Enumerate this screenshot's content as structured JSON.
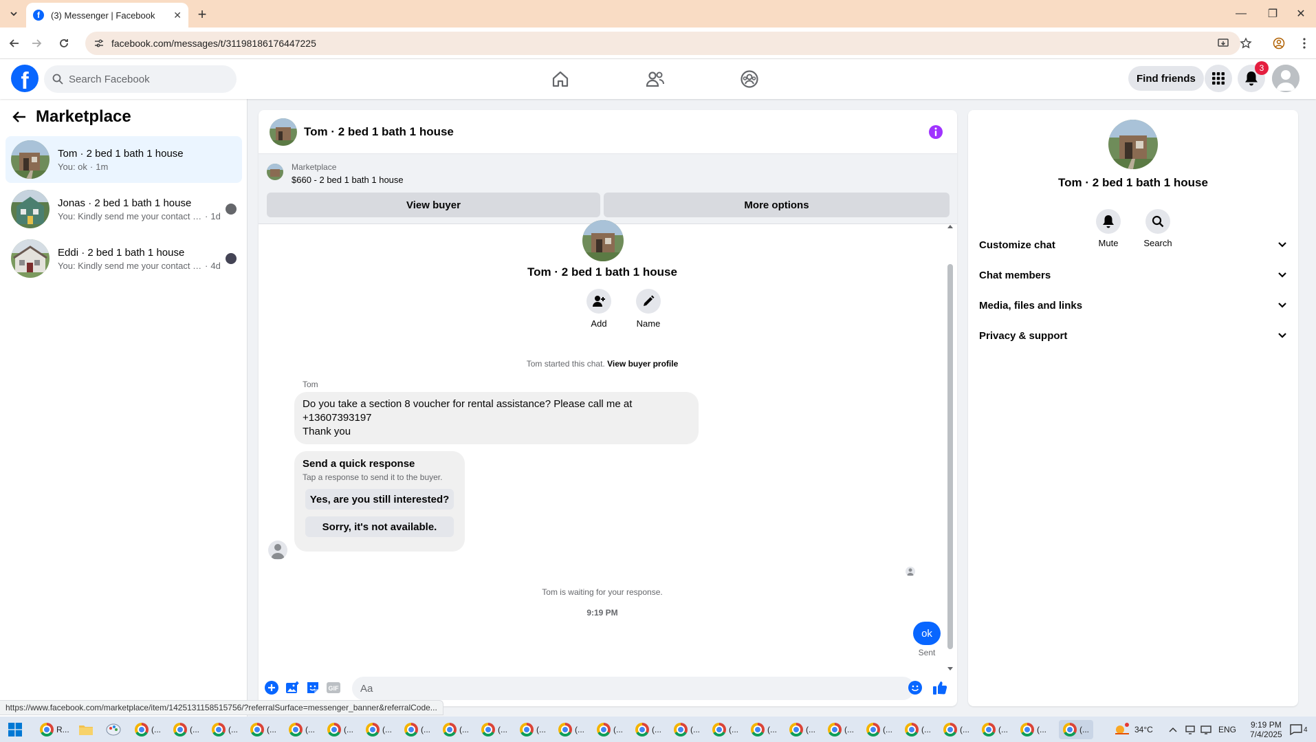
{
  "browser": {
    "tab_title": "(3) Messenger | Facebook",
    "url": "facebook.com/messages/t/31198186176447225",
    "status_url": "https://www.facebook.com/marketplace/item/1425131158515756/?referralSurface=messenger_banner&referralCode..."
  },
  "fbnav": {
    "search_placeholder": "Search Facebook",
    "find_friends": "Find friends",
    "notif_count": "3",
    "brand_color": "#0866ff"
  },
  "sidebar": {
    "title": "Marketplace",
    "conversations": [
      {
        "name": "Tom · 2 bed 1 bath 1 house",
        "preview": "You: ok",
        "time": "1m",
        "active": true
      },
      {
        "name": "Jonas · 2 bed 1 bath 1 house",
        "preview": "You: Kindly send me your contact n...",
        "time": "1d",
        "active": false
      },
      {
        "name": "Eddi · 2 bed 1 bath 1 house",
        "preview": "You: Kindly send me your contact n...",
        "time": "4d",
        "active": false
      }
    ]
  },
  "chat": {
    "header_name": "Tom · 2 bed 1 bath 1 house",
    "marketplace_label": "Marketplace",
    "listing": "$660 - 2 bed 1 bath 1 house",
    "view_buyer": "View buyer",
    "more_options": "More options",
    "profile_name": "Tom · 2 bed 1 bath 1 house",
    "add_label": "Add",
    "name_label": "Name",
    "started_text": "Tom started this chat.",
    "view_buyer_profile": "View buyer profile",
    "sender": "Tom",
    "message_lines": [
      "Do you take a section 8 voucher for rental assistance?  Please call me at",
      "+13607393197",
      "Thank you"
    ],
    "quick_title": "Send a quick response",
    "quick_sub": "Tap a response to send it to the buyer.",
    "quick_1": "Yes, are you still interested?",
    "quick_2": "Sorry, it's not available.",
    "waiting": "Tom is waiting for your response.",
    "time": "9:19 PM",
    "my_message": "ok",
    "sent": "Sent",
    "composer_placeholder": "Aa"
  },
  "details": {
    "name": "Tom · 2 bed 1 bath 1 house",
    "mute": "Mute",
    "search": "Search",
    "rows": [
      "Customize chat",
      "Chat members",
      "Media, files and links",
      "Privacy & support"
    ]
  },
  "taskbar": {
    "first_item": "R...",
    "item_label": "(...",
    "temperature": "34°C",
    "lang": "ENG",
    "clock_time": "9:19 PM",
    "clock_date": "7/4/2025",
    "notif_count": "4"
  }
}
